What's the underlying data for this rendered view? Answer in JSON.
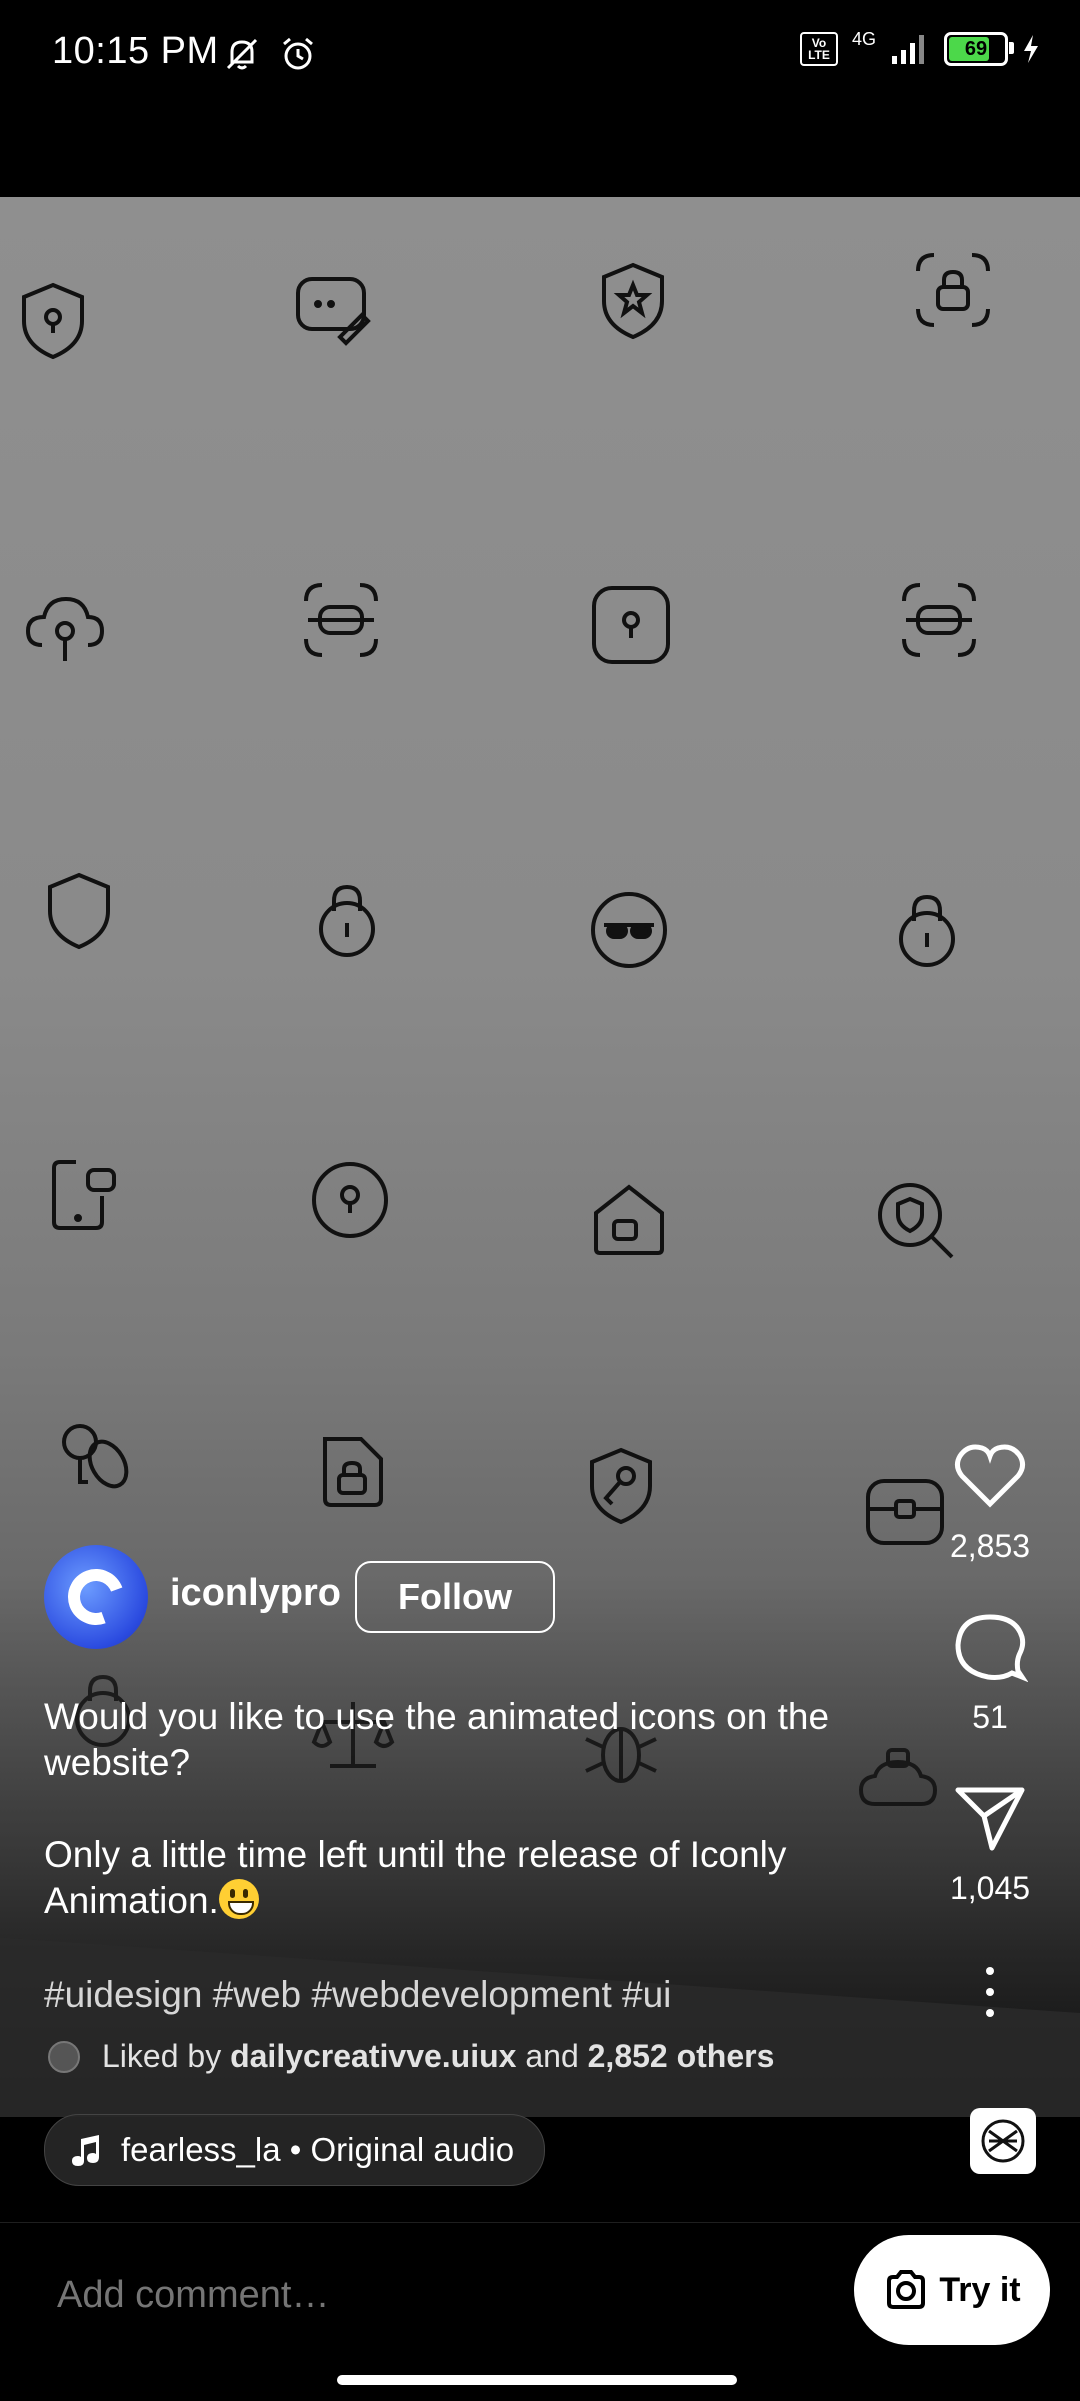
{
  "status": {
    "time": "10:15 PM",
    "network": "4G",
    "volte": "Vo LTE",
    "battery": "69"
  },
  "post": {
    "username": "iconlypro",
    "follow_label": "Follow",
    "caption_1": "Would you like to use the animated icons on the website?",
    "caption_2": "Only a little time left until the release of Iconly Animation.",
    "hashtags": "#uidesign #web #webdevelopment #ui",
    "liked_by_prefix": "Liked by",
    "liked_by_user": "dailycreativve.uiux",
    "liked_by_and": "and",
    "liked_by_others": "2,852 others"
  },
  "actions": {
    "likes": "2,853",
    "comments": "51",
    "shares": "1,045"
  },
  "audio": {
    "label": "fearless_la • Original audio"
  },
  "composer": {
    "placeholder": "Add comment…",
    "try_label": "Try it"
  },
  "icons": {
    "like": "heart-icon",
    "comment": "comment-bubble-icon",
    "share": "paper-plane-icon",
    "more": "more-vertical-icon",
    "audio": "music-note-icon",
    "camera": "camera-icon"
  }
}
